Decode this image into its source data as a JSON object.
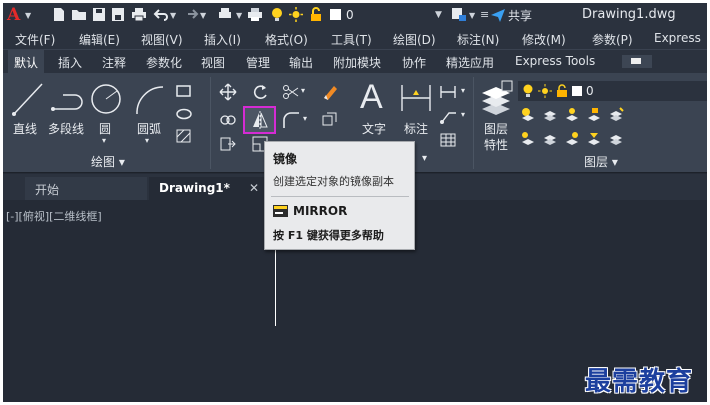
{
  "app": {
    "logo": "A",
    "document_title": "Drawing1.dwg"
  },
  "quick_access": {
    "icons": [
      "new-icon",
      "open-icon",
      "save-icon",
      "save-as-icon",
      "print-icon",
      "undo-icon",
      "redo-icon",
      "plot-icon",
      "sun-icon",
      "lightbulb-icon",
      "lock-icon"
    ],
    "layer_value": "0",
    "share_label": "共享"
  },
  "menu": [
    "文件(F)",
    "编辑(E)",
    "视图(V)",
    "插入(I)",
    "格式(O)",
    "工具(T)",
    "绘图(D)",
    "标注(N)",
    "修改(M)",
    "参数(P)",
    "Express"
  ],
  "ribbon_tabs": [
    "默认",
    "插入",
    "注释",
    "参数化",
    "视图",
    "管理",
    "输出",
    "附加模块",
    "协作",
    "精选应用",
    "Express Tools"
  ],
  "ribbon": {
    "draw": {
      "line": "直线",
      "polyline": "多段线",
      "circle": "圆",
      "arc": "圆弧",
      "footer": "绘图 ▾"
    },
    "annotation": {
      "text": "文字",
      "dimension": "标注"
    },
    "layers": {
      "properties_line1": "图层",
      "properties_line2": "特性",
      "current_layer": "0",
      "footer": "图层 ▾"
    },
    "arrow_down": "▾"
  },
  "doc_tabs": {
    "start": "开始",
    "active": "Drawing1*",
    "close": "✕"
  },
  "viewport_control": "[-][俯视][二维线框]",
  "tooltip": {
    "title": "镜像",
    "description": "创建选定对象的镜像副本",
    "command": "MIRROR",
    "help": "按 F1 键获得更多帮助"
  },
  "watermark": "最需教育",
  "colors": {
    "highlight": "#d52bd4",
    "app_red": "#e22a2a",
    "ribbon_bg": "#3b4452",
    "canvas_bg": "#252b36"
  }
}
